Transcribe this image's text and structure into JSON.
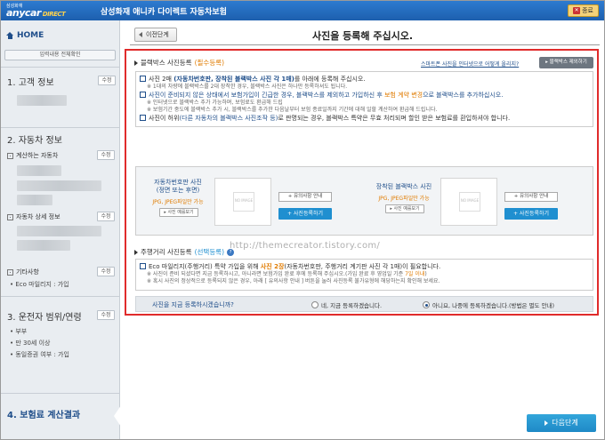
{
  "titlebar": {
    "brand_small": "삼성화재",
    "brand_main": "anycar",
    "brand_direct": "DIRECT",
    "title": "삼성화재 애니카 다이렉트 자동차보험",
    "close_label": "종료"
  },
  "sidebar": {
    "home": "HOME",
    "reset": "입력내용 전체확인",
    "edit_label": "수정",
    "customer": "1. 고객 정보",
    "car": "2. 자동차 정보",
    "car_sub1": "계산하는 자동차",
    "car_sub2": "자동차 상세 정보",
    "car_sub3": "기타사항",
    "car_sub3_item": "• Eco 마일리지 : 가입",
    "driver": "3. 운전자 범위/연령",
    "driver_items": [
      "• 부부",
      "• 만 30세 이상",
      "• 동일증권 여부 : 가입"
    ],
    "result": "4. 보험료 계산결과"
  },
  "main": {
    "prev_btn": "이전단계",
    "page_title": "사진을 등록해 주십시오.",
    "blackbox": {
      "title": "블랙박스 사진등록",
      "required": "(필수등록)",
      "help_link": "스마트폰 사진을 인터넷으로 어떻게 올리지?",
      "exclude_btn": "▸ 블랙박스 제외하기",
      "line1_pre": "사진 2매 ",
      "line1_em": "(자동차번호판, 장착된 블랙박스 사진 각 1매)",
      "line1_post": "를 아래에 등록해 주십시오.",
      "line1_note": "※ 1대의 차량에 블랙박스를 2대 장착한 경우, 블랙박스 사진은 하나만 등록하셔도 됩니다.",
      "line2_pre": "사진이 준비되지 않은 상태에서 보험가입이 긴급한 경우, 블랙박스를 제외하고 가입하신 후 ",
      "line2_em": "보험 계약 변경",
      "line2_post": "으로 블랙박스를 추가하십시오.",
      "line2_note1": "※ 인터넷으로 블랙박스 추가 가능하며, 보험료도 환급해 드립",
      "line2_note2": "※ 보험기간 중도에 블랙박스 추가 시, 블랙박스를 추가한 다음날부터 보험 종료일까지 기간에 대해 일할 계산하여 환급해 드립니다.",
      "line3_pre": "사진이 허위",
      "line3_em": "(다른 자동차의 블랙박스 사진조작 등)",
      "line3_post": "로 판명되는 경우, 블랙박스 특약은 무효 처리되며 할인 받은 보험료를 환입하셔야 합니다."
    },
    "upload": {
      "plate_name": "자동차번호판 사진",
      "plate_sub": "(정면 또는 후면)",
      "fmt": "JPG, JPEG파일만 가능",
      "sample": "▸ 사진 예를보기",
      "bb_name": "장착된 블랙박스 사진",
      "no_image": "NO IMAGE",
      "guide_btn": "+ 유의사항 안내",
      "reg_btn": "+ 사진등록하기"
    },
    "mileage": {
      "title": "주행거리 사진등록",
      "optional": "(선택등록)",
      "help": "?",
      "line1_pre": "Eco 마일리지(주행거리) 특약 가입을 위해 ",
      "line1_em": "사진 2장",
      "line1_post": "(자동차번호판, 주행거리 계기판 사진 각 1매)이 필요합니다.",
      "note1_pre": "※ 사진이 준비 되셨다면 지금 등록하시고, 아니라면 보험가입 완료 후에 등록해 주십시오.(가입 완료 후 영업일 기준 ",
      "note1_em": "7일 이내",
      "note1_post": ")",
      "note2": "※ 혹시 사진의 정상적으로 등록되지 않은 경우, 아래 [ 유의사항 안내 ] 버튼을 눌러 사진등록 불가유형에 해당하는지 확인해 보세요.",
      "question": "사진을 지금 등록하시겠습니까?",
      "option_now": "네, 지금 등록하겠습니다.",
      "option_later": "아니요, 나중에 등록하겠습니다.(방법은 별도 안내)"
    },
    "watermark": "http://themecreator.tistory.com/",
    "next_btn": "다음단계"
  }
}
